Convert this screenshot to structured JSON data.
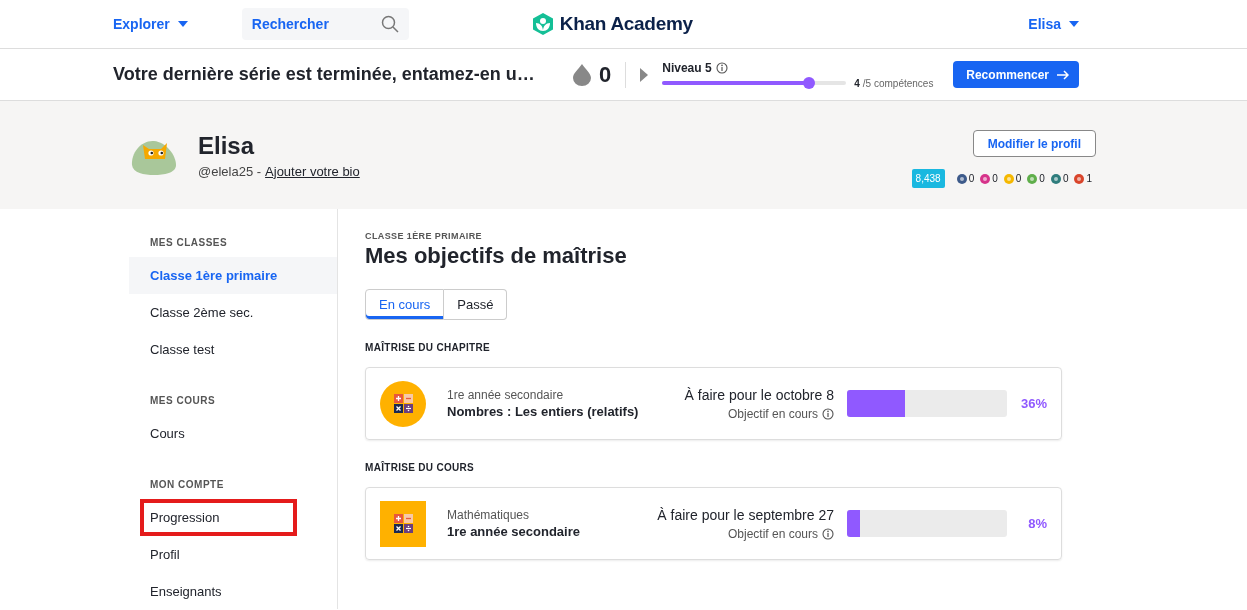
{
  "nav": {
    "explore": "Explorer",
    "search": {
      "placeholder": "Rechercher"
    },
    "logo": "Khan Academy",
    "user": "Elisa"
  },
  "streak": {
    "message": "Votre dernière série est terminée, entamez-en u…",
    "count": "0",
    "level_label": "Niveau 5",
    "level": 0.8,
    "skills_done": "4",
    "skills_total": "/5 compétences",
    "button": "Recommencer"
  },
  "profile": {
    "name": "Elisa",
    "username": "@elela25 -",
    "bio_link": "Ajouter votre bio",
    "edit_button": "Modifier le profil",
    "points": "8,438",
    "badges": [
      {
        "color": "#3d5a8a",
        "count": "0"
      },
      {
        "color": "#d6338a",
        "count": "0"
      },
      {
        "color": "#f5b800",
        "count": "0"
      },
      {
        "color": "#5fae4a",
        "count": "0"
      },
      {
        "color": "#2f7d7d",
        "count": "0"
      },
      {
        "color": "#d9452b",
        "count": "1"
      }
    ]
  },
  "sidebar": {
    "sections": [
      {
        "heading": "MES CLASSES",
        "items": [
          {
            "label": "Classe 1ère primaire",
            "selected": true,
            "highlighted": false
          },
          {
            "label": "Classe 2ème sec.",
            "selected": false,
            "highlighted": false
          },
          {
            "label": "Classe test",
            "selected": false,
            "highlighted": false
          }
        ]
      },
      {
        "heading": "MES COURS",
        "items": [
          {
            "label": "Cours",
            "selected": false,
            "highlighted": false
          }
        ]
      },
      {
        "heading": "MON COMPTE",
        "items": [
          {
            "label": "Progression",
            "selected": false,
            "highlighted": true
          },
          {
            "label": "Profil",
            "selected": false,
            "highlighted": false
          },
          {
            "label": "Enseignants",
            "selected": false,
            "highlighted": false
          }
        ]
      }
    ]
  },
  "main": {
    "eyebrow": "CLASSE 1ÈRE PRIMAIRE",
    "title": "Mes objectifs de maîtrise",
    "tabs": [
      {
        "label": "En cours",
        "selected": true
      },
      {
        "label": "Passé",
        "selected": false
      }
    ],
    "sections": [
      {
        "heading": "MAÎTRISE DU CHAPITRE",
        "goals": [
          {
            "kind": "chapter",
            "subtitle": "1re année secondaire",
            "title": "Nombres : Les entiers (relatifs)",
            "due": "À faire pour le octobre 8",
            "status": "Objectif en cours",
            "level": 0.36,
            "percent": "36%"
          }
        ]
      },
      {
        "heading": "MAÎTRISE DU COURS",
        "goals": [
          {
            "kind": "course",
            "subtitle": "Mathématiques",
            "title": "1re année secondaire",
            "due": "À faire pour le septembre 27",
            "status": "Objectif en cours",
            "level": 0.08,
            "percent": "8%"
          }
        ]
      }
    ]
  }
}
